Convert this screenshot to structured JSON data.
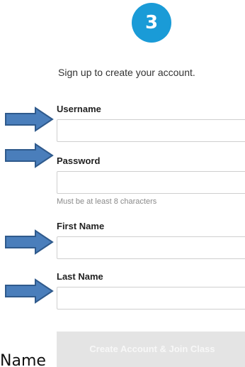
{
  "step": {
    "number": "3",
    "color": "#1a9bd7"
  },
  "subtitle": "Sign up to create your account.",
  "fields": [
    {
      "label": "Username",
      "value": ""
    },
    {
      "label": "Password",
      "value": "",
      "hint": "Must be at least 8 characters"
    },
    {
      "label": "First Name",
      "value": ""
    },
    {
      "label": "Last Name",
      "value": ""
    }
  ],
  "annotation": {
    "arrow_icon": "right-arrow-icon",
    "arrow_color": "#4a7ebb",
    "bottom_text": "Name"
  },
  "submit": {
    "label": "Create Account & Join Class",
    "state": "disabled"
  }
}
